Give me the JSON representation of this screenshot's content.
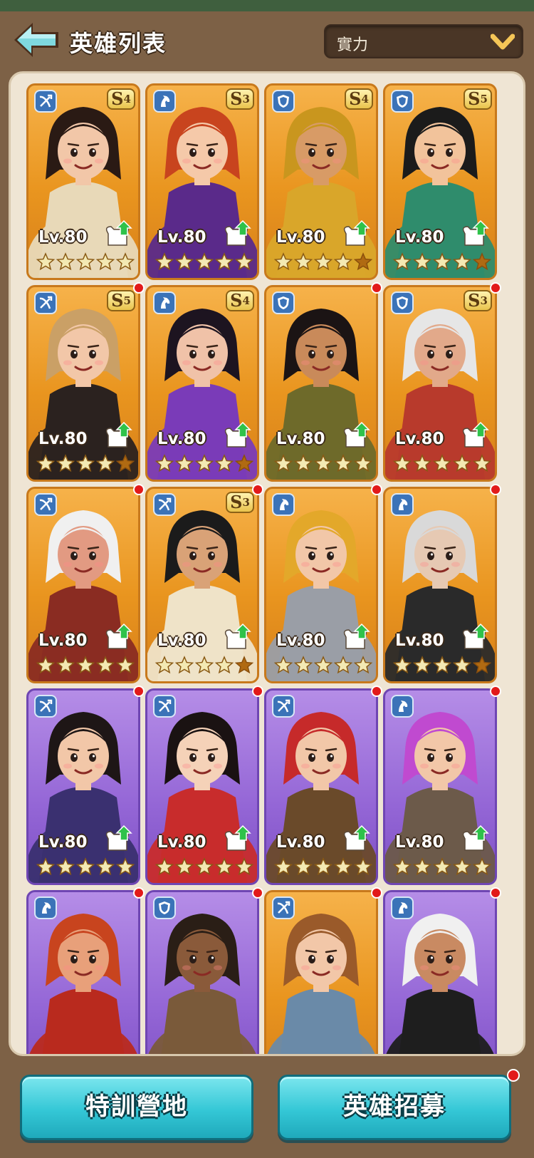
{
  "header": {
    "title": "英雄列表",
    "back_icon": "back-arrow-icon",
    "sort": {
      "selected": "實力",
      "icon": "chevron-down-icon"
    }
  },
  "colors": {
    "accent": "#34c7d6",
    "card_orange": "#e9951f",
    "card_purple": "#9466d6",
    "notify": "#e21a1a"
  },
  "heroes": [
    {
      "rarity": "orange",
      "class": "crossbow-icon",
      "grade": "S",
      "grade_num": "4",
      "level": "Lv.80",
      "stars": 5,
      "notify": false,
      "hair": "#2a1a14",
      "skin": "#f2c7a8",
      "outfit": "#e8d9b8"
    },
    {
      "rarity": "orange",
      "class": "horse-icon",
      "grade": "S",
      "grade_num": "3",
      "level": "Lv.80",
      "stars": 5,
      "notify": false,
      "hair": "#c8441e",
      "skin": "#f5c9a9",
      "outfit": "#5a2a8a"
    },
    {
      "rarity": "orange",
      "class": "shield-icon",
      "grade": "S",
      "grade_num": "4",
      "level": "Lv.80",
      "stars": 4,
      "notify": false,
      "hair": "#c9961e",
      "skin": "#d89b66",
      "outfit": "#d9a62a"
    },
    {
      "rarity": "orange",
      "class": "shield-icon",
      "grade": "S",
      "grade_num": "5",
      "level": "Lv.80",
      "stars": 4,
      "notify": false,
      "hair": "#1b1b1b",
      "skin": "#f2c39b",
      "outfit": "#2f8c6c"
    },
    {
      "rarity": "orange",
      "class": "crossbow-icon",
      "grade": "S",
      "grade_num": "5",
      "level": "Lv.80",
      "stars": 4,
      "notify": true,
      "hair": "#caa066",
      "skin": "#f2c7a8",
      "outfit": "#2b221f"
    },
    {
      "rarity": "orange",
      "class": "horse-icon",
      "grade": "S",
      "grade_num": "4",
      "level": "Lv.80",
      "stars": 4,
      "notify": false,
      "hair": "#1d1420",
      "skin": "#f0c2a8",
      "outfit": "#7a3bb8"
    },
    {
      "rarity": "orange",
      "class": "shield-icon",
      "grade": "",
      "grade_num": "",
      "level": "Lv.80",
      "stars": 5,
      "notify": true,
      "hair": "#1b1414",
      "skin": "#c98a5a",
      "outfit": "#6e6a2a"
    },
    {
      "rarity": "orange",
      "class": "shield-icon",
      "grade": "S",
      "grade_num": "3",
      "level": "Lv.80",
      "stars": 5,
      "notify": true,
      "hair": "#e6e6e6",
      "skin": "#e2a98a",
      "outfit": "#b83a2c"
    },
    {
      "rarity": "orange",
      "class": "crossbow-icon",
      "grade": "",
      "grade_num": "",
      "level": "Lv.80",
      "stars": 5,
      "notify": true,
      "hair": "#f0f0f0",
      "skin": "#e29a82",
      "outfit": "#8a2c22"
    },
    {
      "rarity": "orange",
      "class": "crossbow-icon",
      "grade": "S",
      "grade_num": "3",
      "level": "Lv.80",
      "stars": 4,
      "notify": true,
      "hair": "#1b1b1b",
      "skin": "#d9a277",
      "outfit": "#efe3c8"
    },
    {
      "rarity": "orange",
      "class": "horse-icon",
      "grade": "",
      "grade_num": "",
      "level": "Lv.80",
      "stars": 5,
      "notify": true,
      "hair": "#e3a82a",
      "skin": "#f2c7a8",
      "outfit": "#9a9ea6"
    },
    {
      "rarity": "orange",
      "class": "horse-icon",
      "grade": "",
      "grade_num": "",
      "level": "Lv.80",
      "stars": 4,
      "notify": true,
      "hair": "#d9d9d9",
      "skin": "#e6c9b3",
      "outfit": "#2a2a2a"
    },
    {
      "rarity": "purple",
      "class": "crossbow-icon",
      "grade": "",
      "grade_num": "",
      "level": "Lv.80",
      "stars": 5,
      "notify": true,
      "hair": "#1e1616",
      "skin": "#f2c7a8",
      "outfit": "#3a3070"
    },
    {
      "rarity": "purple",
      "class": "crossbow-icon",
      "grade": "",
      "grade_num": "",
      "level": "Lv.80",
      "stars": 5,
      "notify": true,
      "hair": "#1a1212",
      "skin": "#f5d2b8",
      "outfit": "#c82c2c"
    },
    {
      "rarity": "purple",
      "class": "crossbow-icon",
      "grade": "",
      "grade_num": "",
      "level": "Lv.80",
      "stars": 5,
      "notify": true,
      "hair": "#c62a2a",
      "skin": "#f2c7a8",
      "outfit": "#6a4a2a"
    },
    {
      "rarity": "purple",
      "class": "horse-icon",
      "grade": "",
      "grade_num": "",
      "level": "Lv.80",
      "stars": 5,
      "notify": true,
      "hair": "#c04ad0",
      "skin": "#f2c7a8",
      "outfit": "#6c5a4a"
    },
    {
      "rarity": "purple",
      "class": "horse-icon",
      "grade": "",
      "grade_num": "",
      "level": "",
      "stars": 0,
      "notify": true,
      "hair": "#c8441e",
      "skin": "#e8a07a",
      "outfit": "#b92a1e"
    },
    {
      "rarity": "purple",
      "class": "shield-icon",
      "grade": "",
      "grade_num": "",
      "level": "",
      "stars": 0,
      "notify": true,
      "hair": "#2a1e16",
      "skin": "#8a5a3a",
      "outfit": "#7a5a3a"
    },
    {
      "rarity": "orange",
      "class": "crossbow-icon",
      "grade": "",
      "grade_num": "",
      "level": "",
      "stars": 0,
      "notify": true,
      "hair": "#9a5a2a",
      "skin": "#f2c7a8",
      "outfit": "#6a8aa8"
    },
    {
      "rarity": "purple",
      "class": "horse-icon",
      "grade": "",
      "grade_num": "",
      "level": "",
      "stars": 0,
      "notify": true,
      "hair": "#f0f0f0",
      "skin": "#c98a62",
      "outfit": "#1e1e1e"
    }
  ],
  "buttons": {
    "training": "特訓營地",
    "recruit": "英雄招募",
    "recruit_notify": true
  }
}
